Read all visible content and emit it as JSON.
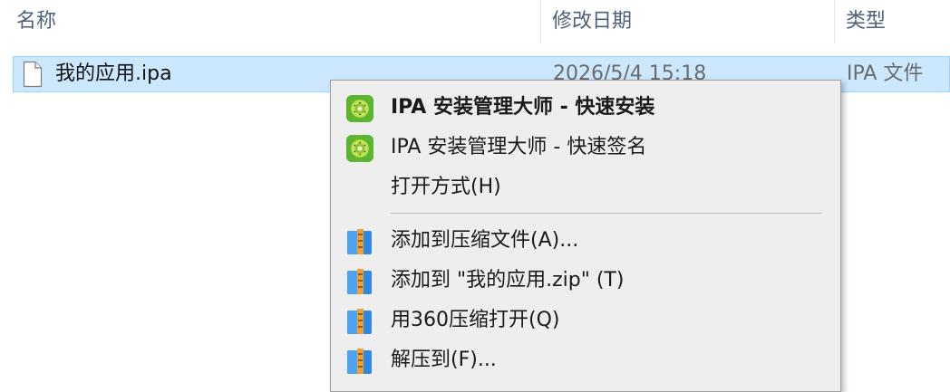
{
  "columns": {
    "name": "名称",
    "date": "修改日期",
    "type": "类型"
  },
  "file": {
    "name": "我的应用.ipa",
    "date": "2026/5/4 15:18",
    "type": "IPA 文件",
    "icon": "blank-document-icon"
  },
  "context_menu": {
    "items": [
      {
        "label": "IPA 安装管理大师 - 快速安装",
        "icon": "kiwi-app-icon",
        "bold": true
      },
      {
        "label": "IPA 安装管理大师 - 快速签名",
        "icon": "kiwi-app-icon"
      },
      {
        "label": "打开方式(H)",
        "icon": ""
      },
      {
        "label": "添加到压缩文件(A)...",
        "icon": "archive-book-icon"
      },
      {
        "label": "添加到 \"我的应用.zip\" (T)",
        "icon": "archive-book-icon"
      },
      {
        "label": "用360压缩打开(Q)",
        "icon": "archive-book-icon"
      },
      {
        "label": "解压到(F)...",
        "icon": "archive-book-icon"
      }
    ]
  },
  "colors": {
    "selection_bg": "#cce8ff",
    "selection_border": "#99d1ff",
    "header_text": "#4c607a",
    "menu_bg": "#eeeeee",
    "kiwi_green": "#5cb531",
    "archive_blue": "#2f8ae5",
    "archive_orange": "#f0a030"
  }
}
